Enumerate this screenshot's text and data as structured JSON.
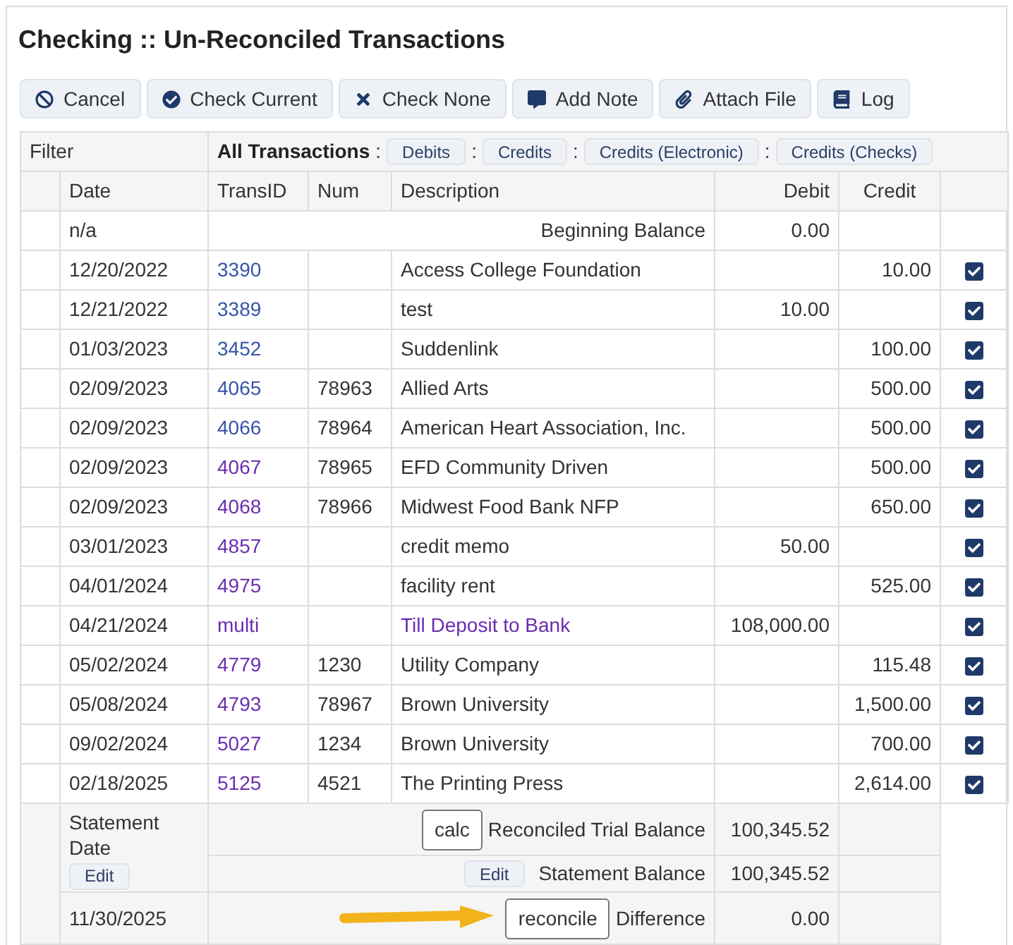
{
  "title": "Checking :: Un-Reconciled Transactions",
  "toolbar": [
    {
      "label": "Cancel",
      "kind": "cancel"
    },
    {
      "label": "Check Current",
      "kind": "check"
    },
    {
      "label": "Check None",
      "kind": "none"
    },
    {
      "label": "Add Note",
      "kind": "note"
    },
    {
      "label": "Attach File",
      "kind": "attach"
    },
    {
      "label": "Log",
      "kind": "log"
    }
  ],
  "filter": {
    "label": "Filter",
    "current": "All Transactions",
    "separator": ":",
    "options": [
      "Debits",
      "Credits",
      "Credits (Electronic)",
      "Credits (Checks)"
    ]
  },
  "columns": [
    "Date",
    "TransID",
    "Num",
    "Description",
    "Debit",
    "Credit"
  ],
  "beginning": {
    "date": "n/a",
    "label": "Beginning Balance",
    "debit": "0.00"
  },
  "rows": [
    {
      "date": "12/20/2022",
      "trans_id": "3390",
      "visited": false,
      "num": "",
      "description": "Access College Foundation",
      "desc_link": false,
      "debit": "",
      "credit": "10.00",
      "checked": true
    },
    {
      "date": "12/21/2022",
      "trans_id": "3389",
      "visited": false,
      "num": "",
      "description": "test",
      "desc_link": false,
      "debit": "10.00",
      "credit": "",
      "checked": true
    },
    {
      "date": "01/03/2023",
      "trans_id": "3452",
      "visited": false,
      "num": "",
      "description": "Suddenlink",
      "desc_link": false,
      "debit": "",
      "credit": "100.00",
      "checked": true
    },
    {
      "date": "02/09/2023",
      "trans_id": "4065",
      "visited": false,
      "num": "78963",
      "description": "Allied Arts",
      "desc_link": false,
      "debit": "",
      "credit": "500.00",
      "checked": true
    },
    {
      "date": "02/09/2023",
      "trans_id": "4066",
      "visited": false,
      "num": "78964",
      "description": "American Heart Association, Inc.",
      "desc_link": false,
      "debit": "",
      "credit": "500.00",
      "checked": true
    },
    {
      "date": "02/09/2023",
      "trans_id": "4067",
      "visited": true,
      "num": "78965",
      "description": "EFD Community Driven",
      "desc_link": false,
      "debit": "",
      "credit": "500.00",
      "checked": true
    },
    {
      "date": "02/09/2023",
      "trans_id": "4068",
      "visited": true,
      "num": "78966",
      "description": "Midwest Food Bank NFP",
      "desc_link": false,
      "debit": "",
      "credit": "650.00",
      "checked": true
    },
    {
      "date": "03/01/2023",
      "trans_id": "4857",
      "visited": true,
      "num": "",
      "description": "credit memo",
      "desc_link": false,
      "debit": "50.00",
      "credit": "",
      "checked": true
    },
    {
      "date": "04/01/2024",
      "trans_id": "4975",
      "visited": true,
      "num": "",
      "description": "facility rent",
      "desc_link": false,
      "debit": "",
      "credit": "525.00",
      "checked": true
    },
    {
      "date": "04/21/2024",
      "trans_id": "multi",
      "visited": true,
      "num": "",
      "description": "Till Deposit to Bank",
      "desc_link": true,
      "debit": "108,000.00",
      "credit": "",
      "checked": true
    },
    {
      "date": "05/02/2024",
      "trans_id": "4779",
      "visited": true,
      "num": "1230",
      "description": "Utility Company",
      "desc_link": false,
      "debit": "",
      "credit": "115.48",
      "checked": true
    },
    {
      "date": "05/08/2024",
      "trans_id": "4793",
      "visited": true,
      "num": "78967",
      "description": "Brown University",
      "desc_link": false,
      "debit": "",
      "credit": "1,500.00",
      "checked": true
    },
    {
      "date": "09/02/2024",
      "trans_id": "5027",
      "visited": true,
      "num": "1234",
      "description": "Brown University",
      "desc_link": false,
      "debit": "",
      "credit": "700.00",
      "checked": true
    },
    {
      "date": "02/18/2025",
      "trans_id": "5125",
      "visited": true,
      "num": "4521",
      "description": "The Printing Press",
      "desc_link": false,
      "debit": "",
      "credit": "2,614.00",
      "checked": true
    }
  ],
  "summary": {
    "statement_date_label": "Statement Date",
    "date_edit": "Edit",
    "statement_date": "11/30/2025",
    "calc": "calc",
    "trial_label": "Reconciled Trial Balance",
    "trial": "100,345.52",
    "balance_edit": "Edit",
    "balance_label": "Statement Balance",
    "balance": "100,345.52",
    "reconcile": "reconcile",
    "difference_label": "Difference",
    "difference": "0.00"
  }
}
